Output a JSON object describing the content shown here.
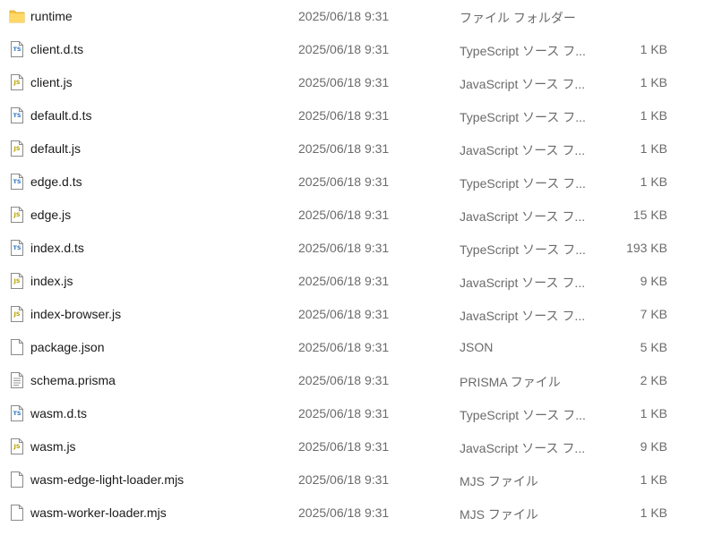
{
  "files": [
    {
      "name": "runtime",
      "date": "2025/06/18 9:31",
      "type": "ファイル フォルダー",
      "size": "",
      "icon": "folder-icon"
    },
    {
      "name": "client.d.ts",
      "date": "2025/06/18 9:31",
      "type": "TypeScript ソース フ...",
      "size": "1 KB",
      "icon": "ts-file-icon"
    },
    {
      "name": "client.js",
      "date": "2025/06/18 9:31",
      "type": "JavaScript ソース フ...",
      "size": "1 KB",
      "icon": "js-file-icon"
    },
    {
      "name": "default.d.ts",
      "date": "2025/06/18 9:31",
      "type": "TypeScript ソース フ...",
      "size": "1 KB",
      "icon": "ts-file-icon"
    },
    {
      "name": "default.js",
      "date": "2025/06/18 9:31",
      "type": "JavaScript ソース フ...",
      "size": "1 KB",
      "icon": "js-file-icon"
    },
    {
      "name": "edge.d.ts",
      "date": "2025/06/18 9:31",
      "type": "TypeScript ソース フ...",
      "size": "1 KB",
      "icon": "ts-file-icon"
    },
    {
      "name": "edge.js",
      "date": "2025/06/18 9:31",
      "type": "JavaScript ソース フ...",
      "size": "15 KB",
      "icon": "js-file-icon"
    },
    {
      "name": "index.d.ts",
      "date": "2025/06/18 9:31",
      "type": "TypeScript ソース フ...",
      "size": "193 KB",
      "icon": "ts-file-icon"
    },
    {
      "name": "index.js",
      "date": "2025/06/18 9:31",
      "type": "JavaScript ソース フ...",
      "size": "9 KB",
      "icon": "js-file-icon"
    },
    {
      "name": "index-browser.js",
      "date": "2025/06/18 9:31",
      "type": "JavaScript ソース フ...",
      "size": "7 KB",
      "icon": "js-file-icon"
    },
    {
      "name": "package.json",
      "date": "2025/06/18 9:31",
      "type": "JSON",
      "size": "5 KB",
      "icon": "blank-file-icon"
    },
    {
      "name": "schema.prisma",
      "date": "2025/06/18 9:31",
      "type": "PRISMA ファイル",
      "size": "2 KB",
      "icon": "text-file-icon"
    },
    {
      "name": "wasm.d.ts",
      "date": "2025/06/18 9:31",
      "type": "TypeScript ソース フ...",
      "size": "1 KB",
      "icon": "ts-file-icon"
    },
    {
      "name": "wasm.js",
      "date": "2025/06/18 9:31",
      "type": "JavaScript ソース フ...",
      "size": "9 KB",
      "icon": "js-file-icon"
    },
    {
      "name": "wasm-edge-light-loader.mjs",
      "date": "2025/06/18 9:31",
      "type": "MJS ファイル",
      "size": "1 KB",
      "icon": "blank-file-icon"
    },
    {
      "name": "wasm-worker-loader.mjs",
      "date": "2025/06/18 9:31",
      "type": "MJS ファイル",
      "size": "1 KB",
      "icon": "blank-file-icon"
    }
  ],
  "colors": {
    "folder": "#f6c344",
    "ts_badge": "#3178c6",
    "js_badge": "#b5a200",
    "muted_text": "#6b6b6b"
  }
}
